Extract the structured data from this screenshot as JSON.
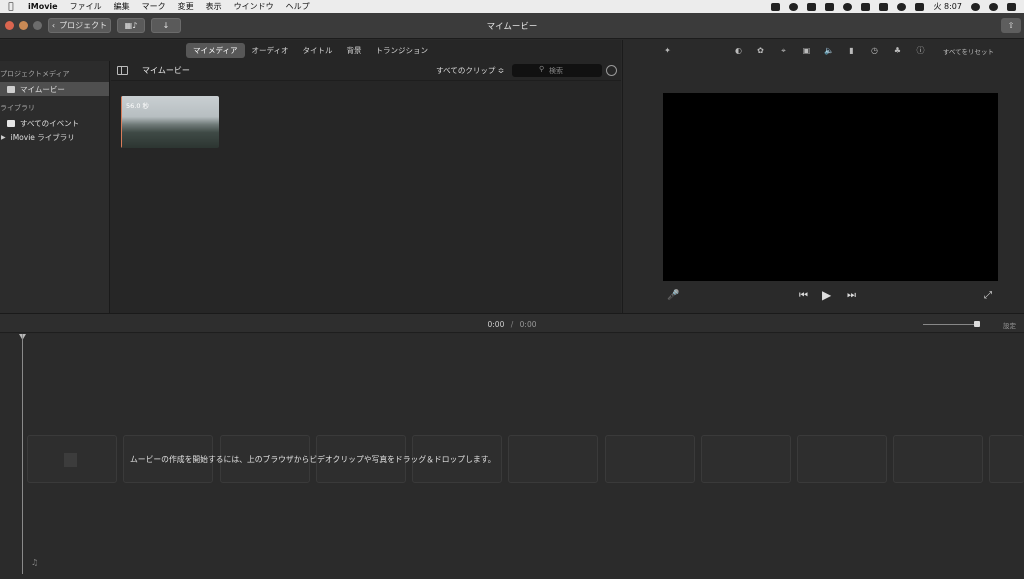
{
  "menubar": {
    "app": "iMovie",
    "items": [
      "ファイル",
      "編集",
      "マーク",
      "変更",
      "表示",
      "ウインドウ",
      "ヘルプ"
    ],
    "clock": "火 8:07"
  },
  "toolbar": {
    "back_label": "プロジェクト",
    "window_title": "マイムービー"
  },
  "browser": {
    "tabs": [
      "マイメディア",
      "オーディオ",
      "タイトル",
      "背景",
      "トランジション"
    ],
    "active_tab": "マイメディア",
    "sidebar": {
      "section_project": "プロジェクトメディア",
      "project_item": "マイムービー",
      "section_library": "ライブラリ",
      "all_events": "すべてのイベント",
      "library_item": "iMovie ライブラリ"
    },
    "content_title": "マイムービー",
    "clip_filter": "すべてのクリップ ≎",
    "search_placeholder": "検索",
    "clip_duration": "56.0 秒"
  },
  "viewer": {
    "reset_all": "すべてをリセット"
  },
  "timeline": {
    "current_time": "0:00",
    "separator": "/",
    "total_time": "0:00",
    "settings": "設定",
    "drop_hint": "ムービーの作成を開始するには、上のブラウザからビデオクリップや写真をドラッグ＆ドロップします。"
  }
}
